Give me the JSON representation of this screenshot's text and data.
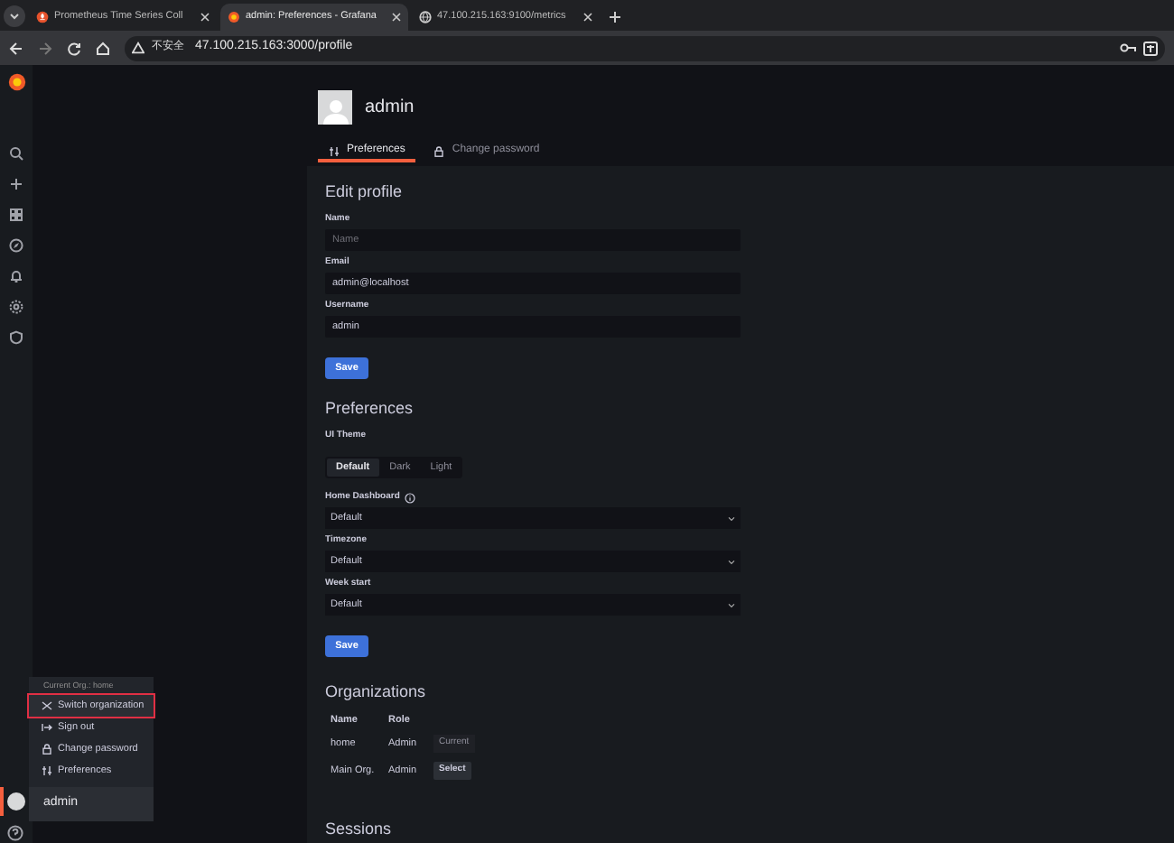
{
  "browser_tabs": [
    {
      "title": "Prometheus Time Series Coll",
      "selected": false,
      "kind": "prometheus"
    },
    {
      "title": "admin: Preferences - Grafana",
      "selected": true,
      "kind": "grafana"
    },
    {
      "title": "47.100.215.163:9100/metrics",
      "selected": false,
      "kind": "globe"
    }
  ],
  "address_bar": {
    "security": "不安全",
    "url": "47.100.215.163:3000/profile"
  },
  "profile": {
    "name": "admin",
    "tabs": [
      {
        "label": "Preferences",
        "selected": true,
        "kind": "sliders"
      },
      {
        "label": "Change password",
        "selected": false,
        "kind": "lock"
      }
    ]
  },
  "edit_profile": {
    "title": "Edit profile",
    "fields": [
      {
        "label": "Name",
        "placeholder": "Name"
      },
      {
        "label": "Email",
        "value": "admin@localhost"
      },
      {
        "label": "Username",
        "value": "admin"
      }
    ],
    "save": "Save"
  },
  "preferences": {
    "title": "Preferences",
    "theme_label": "UI Theme",
    "themes": [
      {
        "label": "Default",
        "selected": true
      },
      {
        "label": "Dark",
        "selected": false
      },
      {
        "label": "Light",
        "selected": false
      }
    ],
    "selects": [
      {
        "label": "Home Dashboard",
        "value": "Default",
        "info": true
      },
      {
        "label": "Timezone",
        "value": "Default",
        "info": false
      },
      {
        "label": "Week start",
        "value": "Default",
        "info": false
      }
    ],
    "save": "Save"
  },
  "organizations": {
    "title": "Organizations",
    "columns": [
      "Name",
      "Role"
    ],
    "rows": [
      {
        "name": "home",
        "role": "Admin",
        "action": {
          "kind": "current",
          "label": "Current"
        }
      },
      {
        "name": "Main Org.",
        "role": "Admin",
        "action": {
          "kind": "button",
          "label": "Select"
        }
      }
    ]
  },
  "sessions": {
    "title": "Sessions"
  },
  "user_menu": {
    "header": "Current Org.: home",
    "items": [
      {
        "label": "Switch organization",
        "kind": "switch",
        "selected": true
      },
      {
        "label": "Sign out",
        "kind": "signout",
        "selected": false
      },
      {
        "label": "Change password",
        "kind": "lock",
        "selected": false
      },
      {
        "label": "Preferences",
        "kind": "sliders",
        "selected": false
      }
    ],
    "user": "admin"
  }
}
